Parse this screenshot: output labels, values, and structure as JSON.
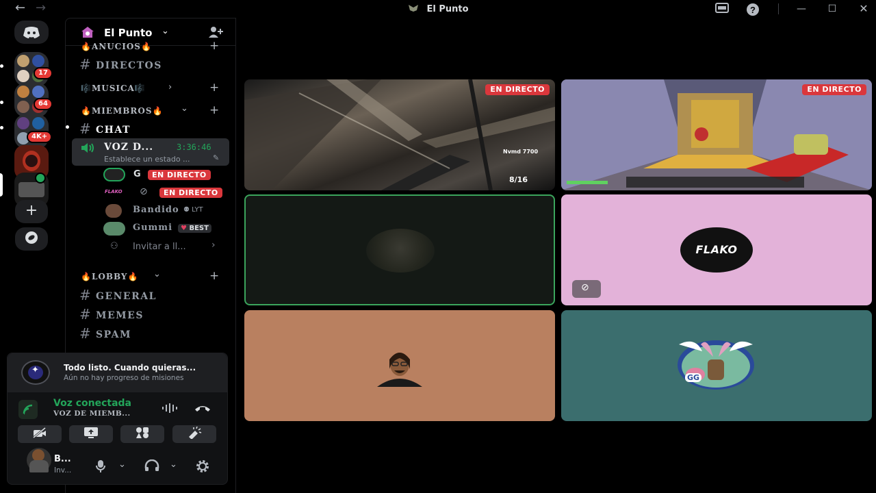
{
  "titlebar": {
    "title": "El Punto",
    "back_icon": "arrow-left-icon",
    "forward_icon": "arrow-right-icon"
  },
  "servers": {
    "badges": [
      "17",
      "64",
      "4K+"
    ]
  },
  "guild": {
    "name": "El Punto"
  },
  "categories": [
    {
      "label": "🔥ANUCIOS🔥"
    },
    {
      "label": "🎼MUSICA🎼"
    },
    {
      "label": "🔥MIEMBROS🔥"
    },
    {
      "label": "🔥LOBBY🔥"
    }
  ],
  "channels": {
    "directos": "DIRECTOS",
    "chat": "CHAT",
    "general": "GENERAL",
    "memes": "MEMES",
    "spam": "SPAM"
  },
  "voice_channel": {
    "name": "VOZ D...",
    "timer": "3:36:46",
    "status": "Establece un estado ..."
  },
  "voice_members": [
    {
      "name": "G",
      "tag": "EN DIRECTO"
    },
    {
      "name": "FLAKO",
      "tag": "EN DIRECTO"
    },
    {
      "name": "Bandido",
      "tag": "LYT"
    },
    {
      "name": "Gummi",
      "tag": "BEST"
    }
  ],
  "invite": {
    "label": "Invitar a ll..."
  },
  "quest": {
    "title": "Todo listo. Cuando quieras...",
    "subtitle": "Aún no hay progreso de misiones"
  },
  "voice_status": {
    "title": "Voz conectada",
    "channel": "VOZ DE MIEMB..."
  },
  "user": {
    "name": "B...",
    "status": "Inv..."
  },
  "stage": {
    "live_label": "EN DIRECTO",
    "game_hud": {
      "score": "7700",
      "ammo": "8/16",
      "name_tag": "Nvmd"
    },
    "flako_logo": "FLAKO",
    "gg_label": "GG"
  },
  "colors": {
    "live": "#da373c",
    "connected": "#23a55a",
    "badge": "#e53935",
    "tile_pink": "#e3b2d9",
    "tile_tan": "#b98060",
    "tile_teal": "#3b6e6e"
  }
}
